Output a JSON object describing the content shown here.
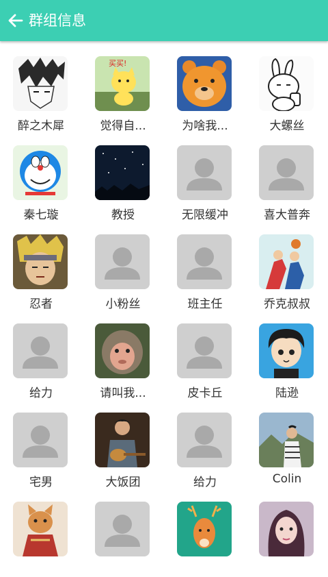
{
  "header": {
    "title": "群组信息",
    "bg_color": "#3ccfb3",
    "back_icon": "arrow-left-icon"
  },
  "members": [
    {
      "name": "醉之木犀",
      "avatar": "manga-boy"
    },
    {
      "name": "觉得自...",
      "avatar": "cat-cartoon"
    },
    {
      "name": "为啥我...",
      "avatar": "bear-cartoon"
    },
    {
      "name": "大螺丝",
      "avatar": "rabbit-sketch"
    },
    {
      "name": "秦七璇",
      "avatar": "doraemon"
    },
    {
      "name": "教授",
      "avatar": "night-sky"
    },
    {
      "name": "无限缓冲",
      "avatar": "default"
    },
    {
      "name": "喜大普奔",
      "avatar": "default"
    },
    {
      "name": "忍者",
      "avatar": "ninja"
    },
    {
      "name": "小粉丝",
      "avatar": "default"
    },
    {
      "name": "班主任",
      "avatar": "default"
    },
    {
      "name": "乔克叔叔",
      "avatar": "basketball"
    },
    {
      "name": "给力",
      "avatar": "default"
    },
    {
      "name": "请叫我...",
      "avatar": "monkey"
    },
    {
      "name": "皮卡丘",
      "avatar": "default"
    },
    {
      "name": "陆逊",
      "avatar": "cartoon-boy"
    },
    {
      "name": "宅男",
      "avatar": "default"
    },
    {
      "name": "大饭团",
      "avatar": "guitar-player"
    },
    {
      "name": "给力",
      "avatar": "default"
    },
    {
      "name": "Colin",
      "avatar": "mountain-photo"
    },
    {
      "name": "",
      "avatar": "dog-costume"
    },
    {
      "name": "",
      "avatar": "default"
    },
    {
      "name": "",
      "avatar": "deer"
    },
    {
      "name": "",
      "avatar": "girl-photo"
    }
  ]
}
